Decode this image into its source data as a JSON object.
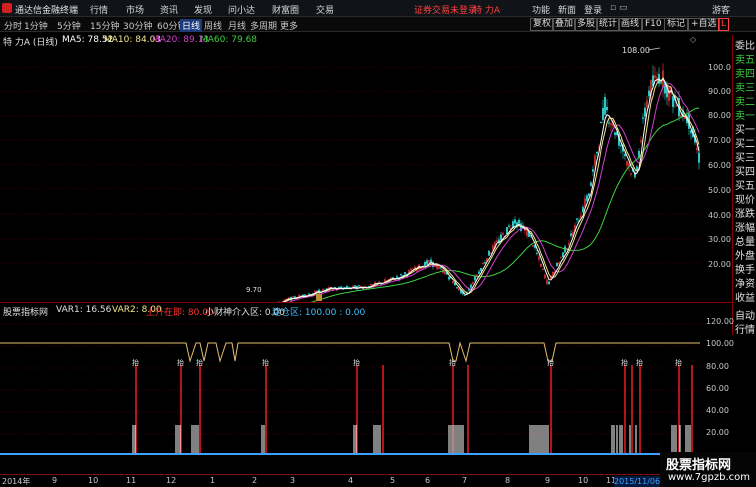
{
  "app": {
    "title": "通达信金融终端"
  },
  "menu": [
    "行情",
    "市场",
    "资讯",
    "发现",
    "问小达",
    "财富圈",
    "交易"
  ],
  "status": {
    "warning": "证券交易未登录",
    "stock_short": "特 力A"
  },
  "window_buttons": [
    "功能",
    "新面",
    "登录",
    "游客"
  ],
  "periods": [
    "分时",
    "1分钟",
    "5分钟",
    "15分钟",
    "30分钟",
    "60分钟",
    "日线",
    "周线",
    "月线",
    "多周期",
    "更多"
  ],
  "right_tools": [
    "复权",
    "叠加",
    "多股",
    "统计",
    "画线",
    "F10",
    "标记",
    "+自选"
  ],
  "main_legend": {
    "stock": "特 力A (日线)",
    "ma5": "MA5: 78.52",
    "ma10": "MA10: 84.03",
    "ma20": "MA20: 89.13",
    "ma60": "MA60: 79.68"
  },
  "high_label": "108.00",
  "low_label": "9.70",
  "sub_legend": {
    "name": "股票指标网",
    "var1": "VAR1: 16.56",
    "var2": "VAR2: 8.00",
    "up": "上升在即: 80.00",
    "mid": "小财神介入区: 0.00",
    "build": "建仓区: 100.00 : 0.00"
  },
  "right_side_top": [
    "委比",
    "卖五",
    "卖四",
    "卖三",
    "卖二",
    "卖一",
    "买一",
    "买二",
    "买三",
    "买四",
    "买五",
    "现价",
    "涨跌",
    "涨幅",
    "总量",
    "外盘",
    "换手",
    "净资",
    "收益"
  ],
  "right_side_bottom": [
    "自动",
    "行情"
  ],
  "main_axis": [
    "100.0",
    "90.00",
    "80.00",
    "70.00",
    "60.00",
    "50.00",
    "40.00",
    "30.00",
    "20.00"
  ],
  "sub_axis": [
    "120.00",
    "100.00",
    "80.00",
    "60.00",
    "40.00",
    "20.00"
  ],
  "dates": [
    "2014年",
    "9",
    "10",
    "11",
    "12",
    "1",
    "2",
    "3",
    "4",
    "5",
    "6",
    "7",
    "8",
    "9",
    "10",
    "11",
    "2015/11/06/五"
  ],
  "signal_label": "抬",
  "watermark": {
    "cn": "股票指标网",
    "url": "www.7gpzb.com"
  },
  "colors": {
    "ma5": "#ffffff",
    "ma10": "#f0e68c",
    "ma20": "#d040d0",
    "ma60": "#40d040",
    "accent": "#ff3030"
  }
}
